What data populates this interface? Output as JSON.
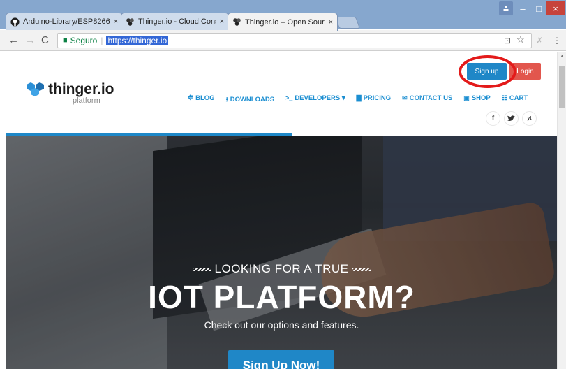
{
  "tabs": [
    {
      "title": "Arduino-Library/ESP8266",
      "icon": "github-icon"
    },
    {
      "title": "Thinger.io - Cloud Consol",
      "icon": "thinger-icon"
    },
    {
      "title": "Thinger.io – Open Source",
      "icon": "thinger-icon"
    }
  ],
  "tab_close": "×",
  "window": {
    "minimize": "–",
    "maximize": "□",
    "close": "×"
  },
  "address": {
    "secure_label": "Seguro",
    "url": "https://thinger.io"
  },
  "header": {
    "logo": "thinger.io",
    "logo_sub": "platform",
    "signup": "Sign up",
    "login": "Login",
    "nav": [
      {
        "icon": "rss-icon",
        "glyph": "⭅",
        "label": "BLOG"
      },
      {
        "icon": "download-icon",
        "glyph": "⭳",
        "label": "DOWNLOADS"
      },
      {
        "icon": "terminal-icon",
        "glyph": ">_",
        "label": "DEVELOPERS ▾"
      },
      {
        "icon": "chart-icon",
        "glyph": "▇",
        "label": "PRICING"
      },
      {
        "icon": "envelope-icon",
        "glyph": "✉",
        "label": "CONTACT US"
      },
      {
        "icon": "bag-icon",
        "glyph": "▣",
        "label": "SHOP"
      },
      {
        "icon": "cart-icon",
        "glyph": "☷",
        "label": "CART"
      }
    ],
    "social": [
      "f",
      "t",
      "yt"
    ]
  },
  "hero": {
    "kicker": "LOOKING FOR A TRUE",
    "title": "IOT PLATFORM?",
    "subtitle": "Check out our options and features.",
    "cta": "Sign Up Now!"
  },
  "colors": {
    "accent": "#1f87c7",
    "login": "#e2564d",
    "highlight": "#e31a1a"
  }
}
